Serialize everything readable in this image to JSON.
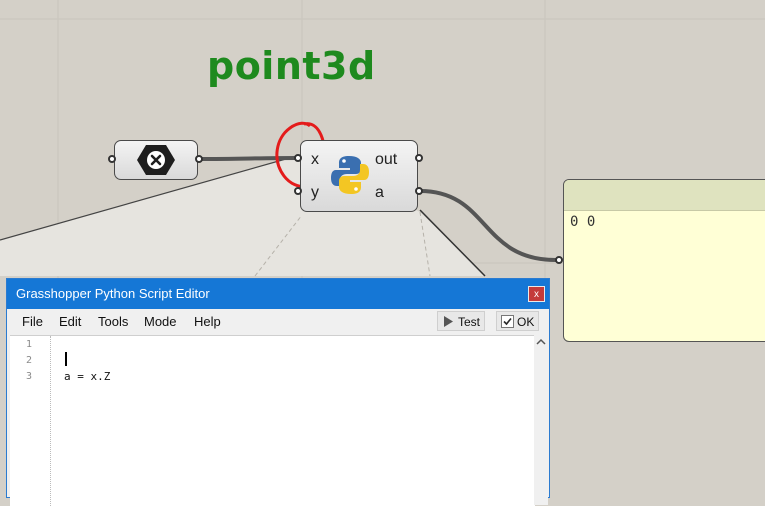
{
  "canvas": {
    "annotation_title": "point3d",
    "colors": {
      "background": "#d4d0c8",
      "annotation_text": "#1e8a1e",
      "annotation_circle": "#e41b1b"
    }
  },
  "param_node": {
    "icon": "close-hex-icon"
  },
  "python_component": {
    "inputs": [
      "x",
      "y"
    ],
    "outputs": [
      "out",
      "a"
    ],
    "icon": "python-logo-icon"
  },
  "panel": {
    "content": "0 0"
  },
  "editor": {
    "title": "Grasshopper Python Script Editor",
    "close_label": "x",
    "menu": [
      "File",
      "Edit",
      "Tools",
      "Mode",
      "Help"
    ],
    "test_label": "Test",
    "ok_label": "OK",
    "line_numbers": [
      "1",
      "2",
      "3"
    ],
    "code_lines": [
      "",
      "",
      "a = x.Z"
    ]
  }
}
